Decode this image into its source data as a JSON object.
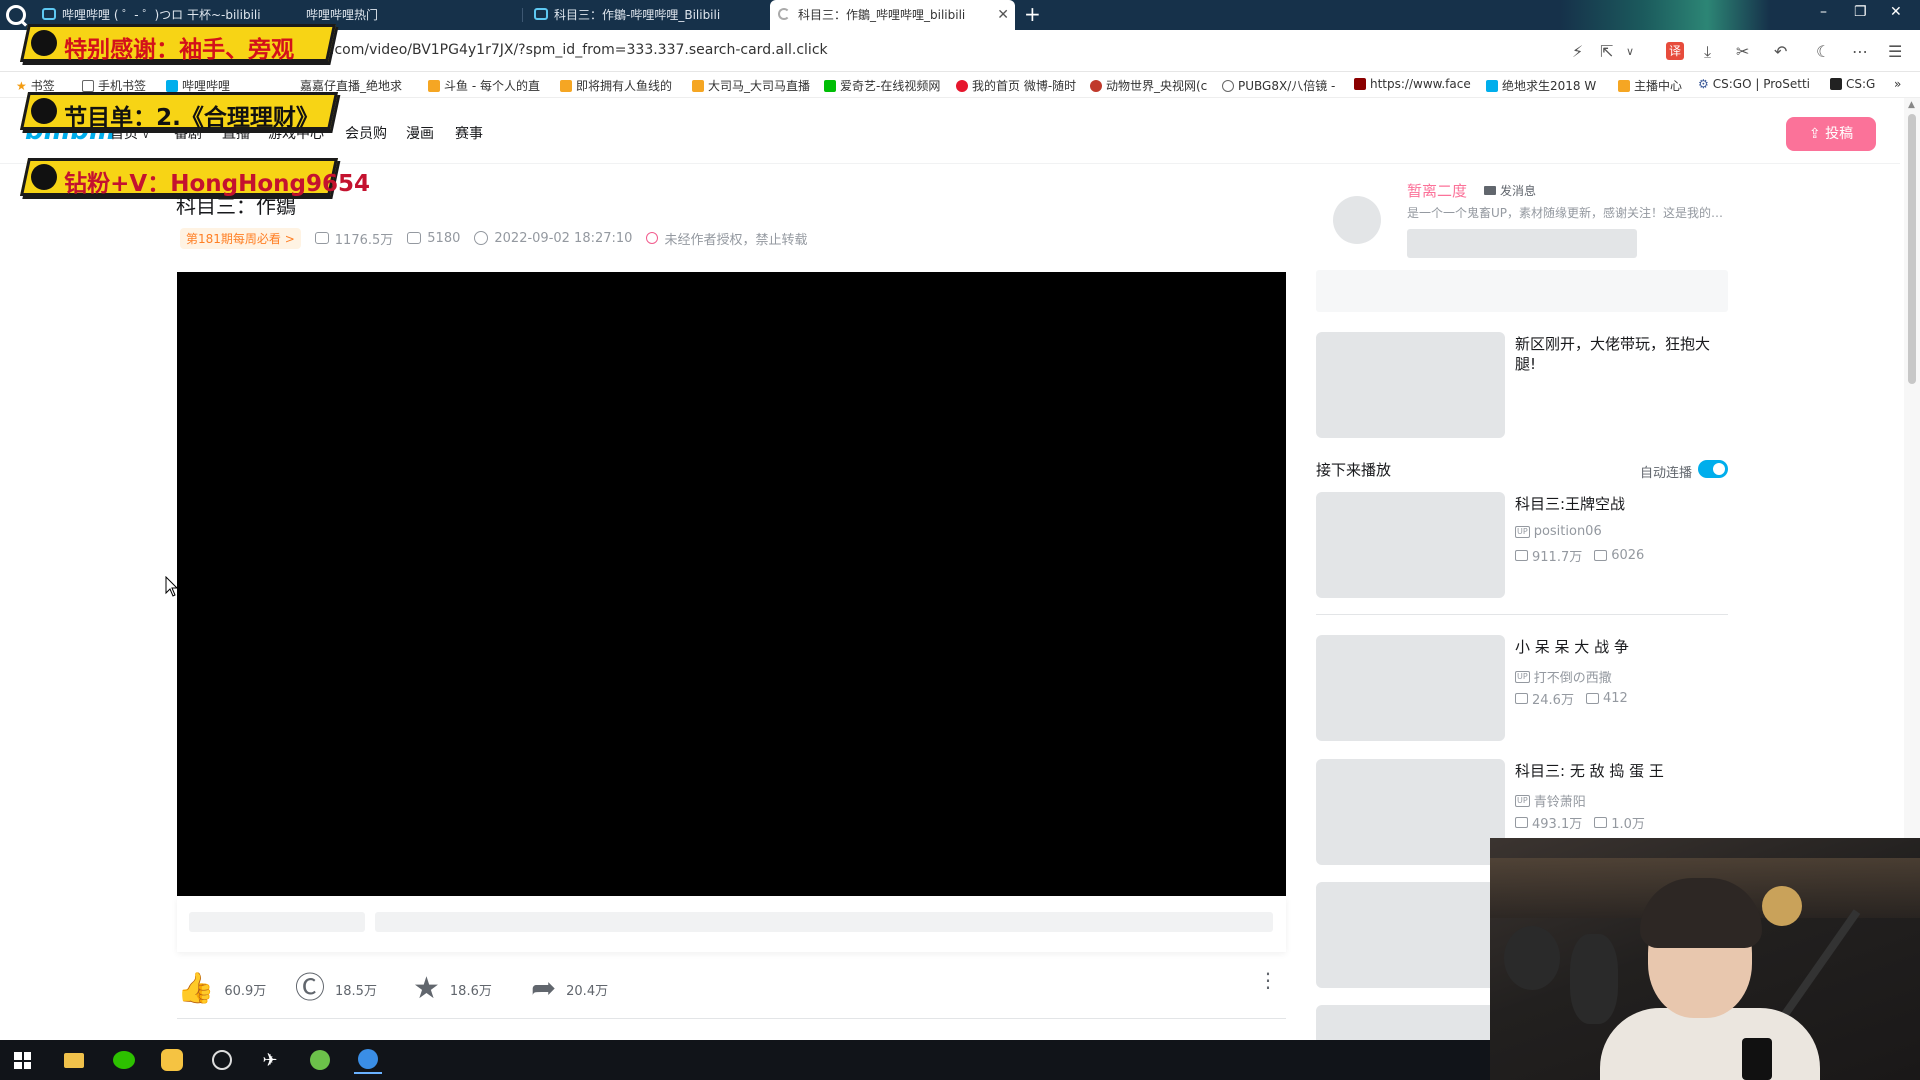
{
  "tabs": [
    {
      "title": "哔哩哔哩 ( ゜- ゜)つロ 干杯~-bilibili"
    },
    {
      "title": "哔哩哔哩热门"
    },
    {
      "title": "科目三：作鶵-哔哩哔哩_Bilibili"
    },
    {
      "title": "科目三：作鶵_哔哩哔哩_bilibili",
      "active": true
    }
  ],
  "address_bar": {
    "url": ".com/video/BV1PG4y1r7JX/?spm_id_from=333.337.search-card.all.click",
    "translate_label": "译"
  },
  "bookmarks": [
    "书签",
    "手机书签",
    "哔哩哔哩",
    "嘉嘉仔直播_绝地求",
    "斗鱼 - 每个人的直",
    "即将拥有人鱼线的",
    "大司马_大司马直播",
    "爱奇艺-在线视频网",
    "我的首页 微博-随时",
    "动物世界_央视网(c",
    "PUBG8X/八倍镜 -",
    "https://www.face",
    "绝地求生2018 W",
    "主播中心",
    "CS:GO | ProSetti",
    "CS:G"
  ],
  "overlay_banners": [
    {
      "text": "特别感谢：袖手、旁观"
    },
    {
      "text": "节目单：2.《合理理财》"
    },
    {
      "text": "钻粉+V：HongHong9654"
    }
  ],
  "site": {
    "logo": "bilibili",
    "nav": [
      "首页",
      "番剧",
      "直播",
      "游戏中心",
      "会员购",
      "漫画",
      "赛事"
    ],
    "upload_label": "投稿"
  },
  "video": {
    "title": "科目三：作鶵",
    "weekly_badge": "第181期每周必看 >",
    "views": "1176.5万",
    "danmaku": "5180",
    "date": "2022-09-02 18:27:10",
    "notice": "未经作者授权，禁止转载",
    "likes": "60.9万",
    "coins": "18.5万",
    "favorites": "18.6万",
    "shares": "20.4万"
  },
  "uploader": {
    "name": "暂离二度",
    "message_label": "发消息",
    "description": "是一个一个鬼畜UP，素材随缘更新，感谢关注！这是我的个人简介"
  },
  "recommend_top": {
    "title": "新区刚开，大佬带玩，狂抱大腿!"
  },
  "next_up": {
    "title": "接下来播放",
    "autoplay_label": "自动连播",
    "autoplay_on": true
  },
  "recommendations": [
    {
      "title": "科目三:王牌空战",
      "up": "position06",
      "views": "911.7万",
      "danmaku": "6026"
    },
    {
      "title": "小 呆 呆 大 战 争",
      "up": "打不倒の西撒",
      "views": "24.6万",
      "danmaku": "412"
    },
    {
      "title": "科目三: 无 敌 捣 蛋 王",
      "up": "青铃萧阳",
      "views": "493.1万",
      "danmaku": "1.0万"
    }
  ],
  "taskbar": [
    "windows-start",
    "file-explorer",
    "wechat",
    "owl-app",
    "game-app",
    "feather-app",
    "green-app",
    "browser-app"
  ]
}
